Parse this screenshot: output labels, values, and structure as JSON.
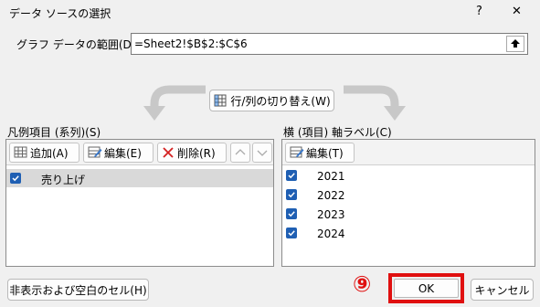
{
  "window": {
    "title": "データ ソースの選択",
    "help_glyph": "?",
    "close_glyph": "✕"
  },
  "range": {
    "label": "グラフ データの範囲(D):",
    "value": "=Sheet2!$B$2:$C$6"
  },
  "switch_button": {
    "label": "行/列の切り替え(W)"
  },
  "legend_section": {
    "label": "凡例項目 (系列)(S)",
    "add_label": "追加(A)",
    "edit_label": "編集(E)",
    "delete_label": "削除(R)",
    "items": [
      {
        "label": "売り上げ",
        "checked": true
      }
    ]
  },
  "axis_section": {
    "label": "横 (項目) 軸ラベル(C)",
    "edit_label": "編集(T)",
    "items": [
      {
        "label": "2021",
        "checked": true
      },
      {
        "label": "2022",
        "checked": true
      },
      {
        "label": "2023",
        "checked": true
      },
      {
        "label": "2024",
        "checked": true
      }
    ]
  },
  "footer": {
    "hidden_cells_label": "非表示および空白のセル(H)",
    "step_marker": "⑨",
    "ok_label": "OK",
    "cancel_label": "キャンセル"
  },
  "colors": {
    "accent": "#1f5fb3",
    "highlight_red": "#e01010",
    "selected_row": "#d9d9d9"
  }
}
